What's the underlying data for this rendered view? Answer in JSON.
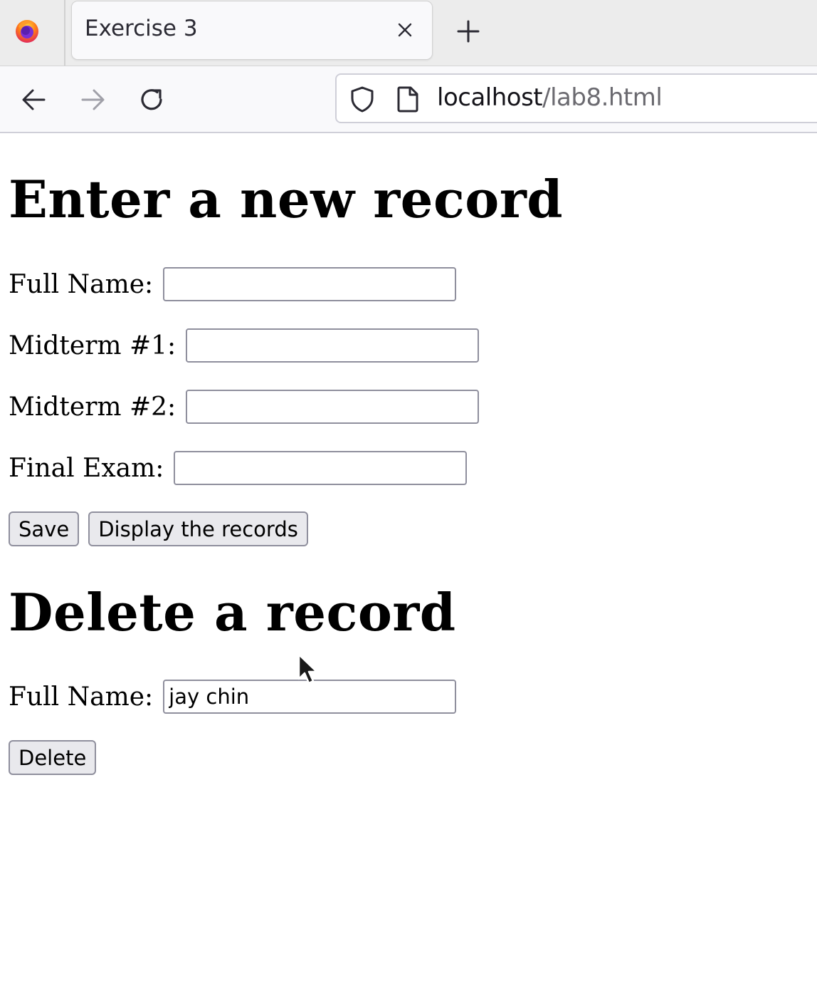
{
  "browser": {
    "tab": {
      "title": "Exercise 3"
    },
    "url": {
      "host": "localhost",
      "path": "/lab8.html"
    },
    "icons": {
      "app": "firefox-icon",
      "tab_close": "close-icon",
      "new_tab": "plus-icon",
      "back": "arrow-left-icon",
      "forward": "arrow-right-icon",
      "reload": "reload-icon",
      "security": "shield-icon",
      "page": "page-icon"
    }
  },
  "add_section": {
    "heading": "Enter a new record",
    "fields": {
      "full_name": {
        "label": "Full Name:",
        "value": ""
      },
      "midterm1": {
        "label": "Midterm #1:",
        "value": ""
      },
      "midterm2": {
        "label": "Midterm #2:",
        "value": ""
      },
      "final_exam": {
        "label": "Final Exam:",
        "value": ""
      }
    },
    "buttons": {
      "save": "Save",
      "display": "Display the records"
    }
  },
  "delete_section": {
    "heading": "Delete a record",
    "fields": {
      "full_name": {
        "label": "Full Name:",
        "value": "jay chin"
      }
    },
    "buttons": {
      "delete": "Delete"
    }
  }
}
